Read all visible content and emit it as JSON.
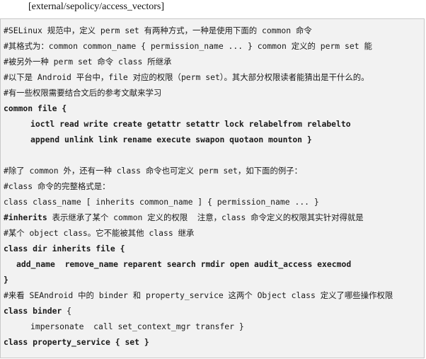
{
  "caption": "[external/sepolicy/access_vectors]",
  "lines": [
    "#SELinux 规范中，定义 perm set 有两种方式，一种是使用下面的 common 命令",
    "#其格式为：common common_name { permission_name ... } common 定义的 perm set 能",
    "#被另外一种 perm set 命令 class 所继承",
    "#以下是 Android 平台中，file 对应的权限（perm set）。其大部分权限读者能猜出是干什么的。",
    "#有一些权限需要结合文后的参考文献来学习",
    "common file {",
    "ioctl read write create getattr setattr lock relabelfrom relabelto",
    "append unlink link rename execute swapon quotaon mounton }",
    "#除了 common 外，还有一种 class 命令也可定义 perm set，如下面的例子：",
    "#class 命令的完整格式是：",
    "class class_name [ inherits common_name ] { permission_name ... }",
    "表示继承了某个 common 定义的权限  注意，class 命令定义的权限其实针对得就是",
    "#某个 object class。它不能被其他 class 继承",
    "class dir inherits file {",
    "add_name  remove_name reparent search rmdir open audit_access execmod",
    "}",
    "#来看 SEAndroid 中的 binder 和 property_service 这两个 Object class 定义了哪些操作权限",
    "{",
    "impersonate  call set_context_mgr transfer }",
    "class property_service { set }"
  ],
  "inline": {
    "inherits_kw": "#inherits",
    "class_binder": "class binder"
  }
}
